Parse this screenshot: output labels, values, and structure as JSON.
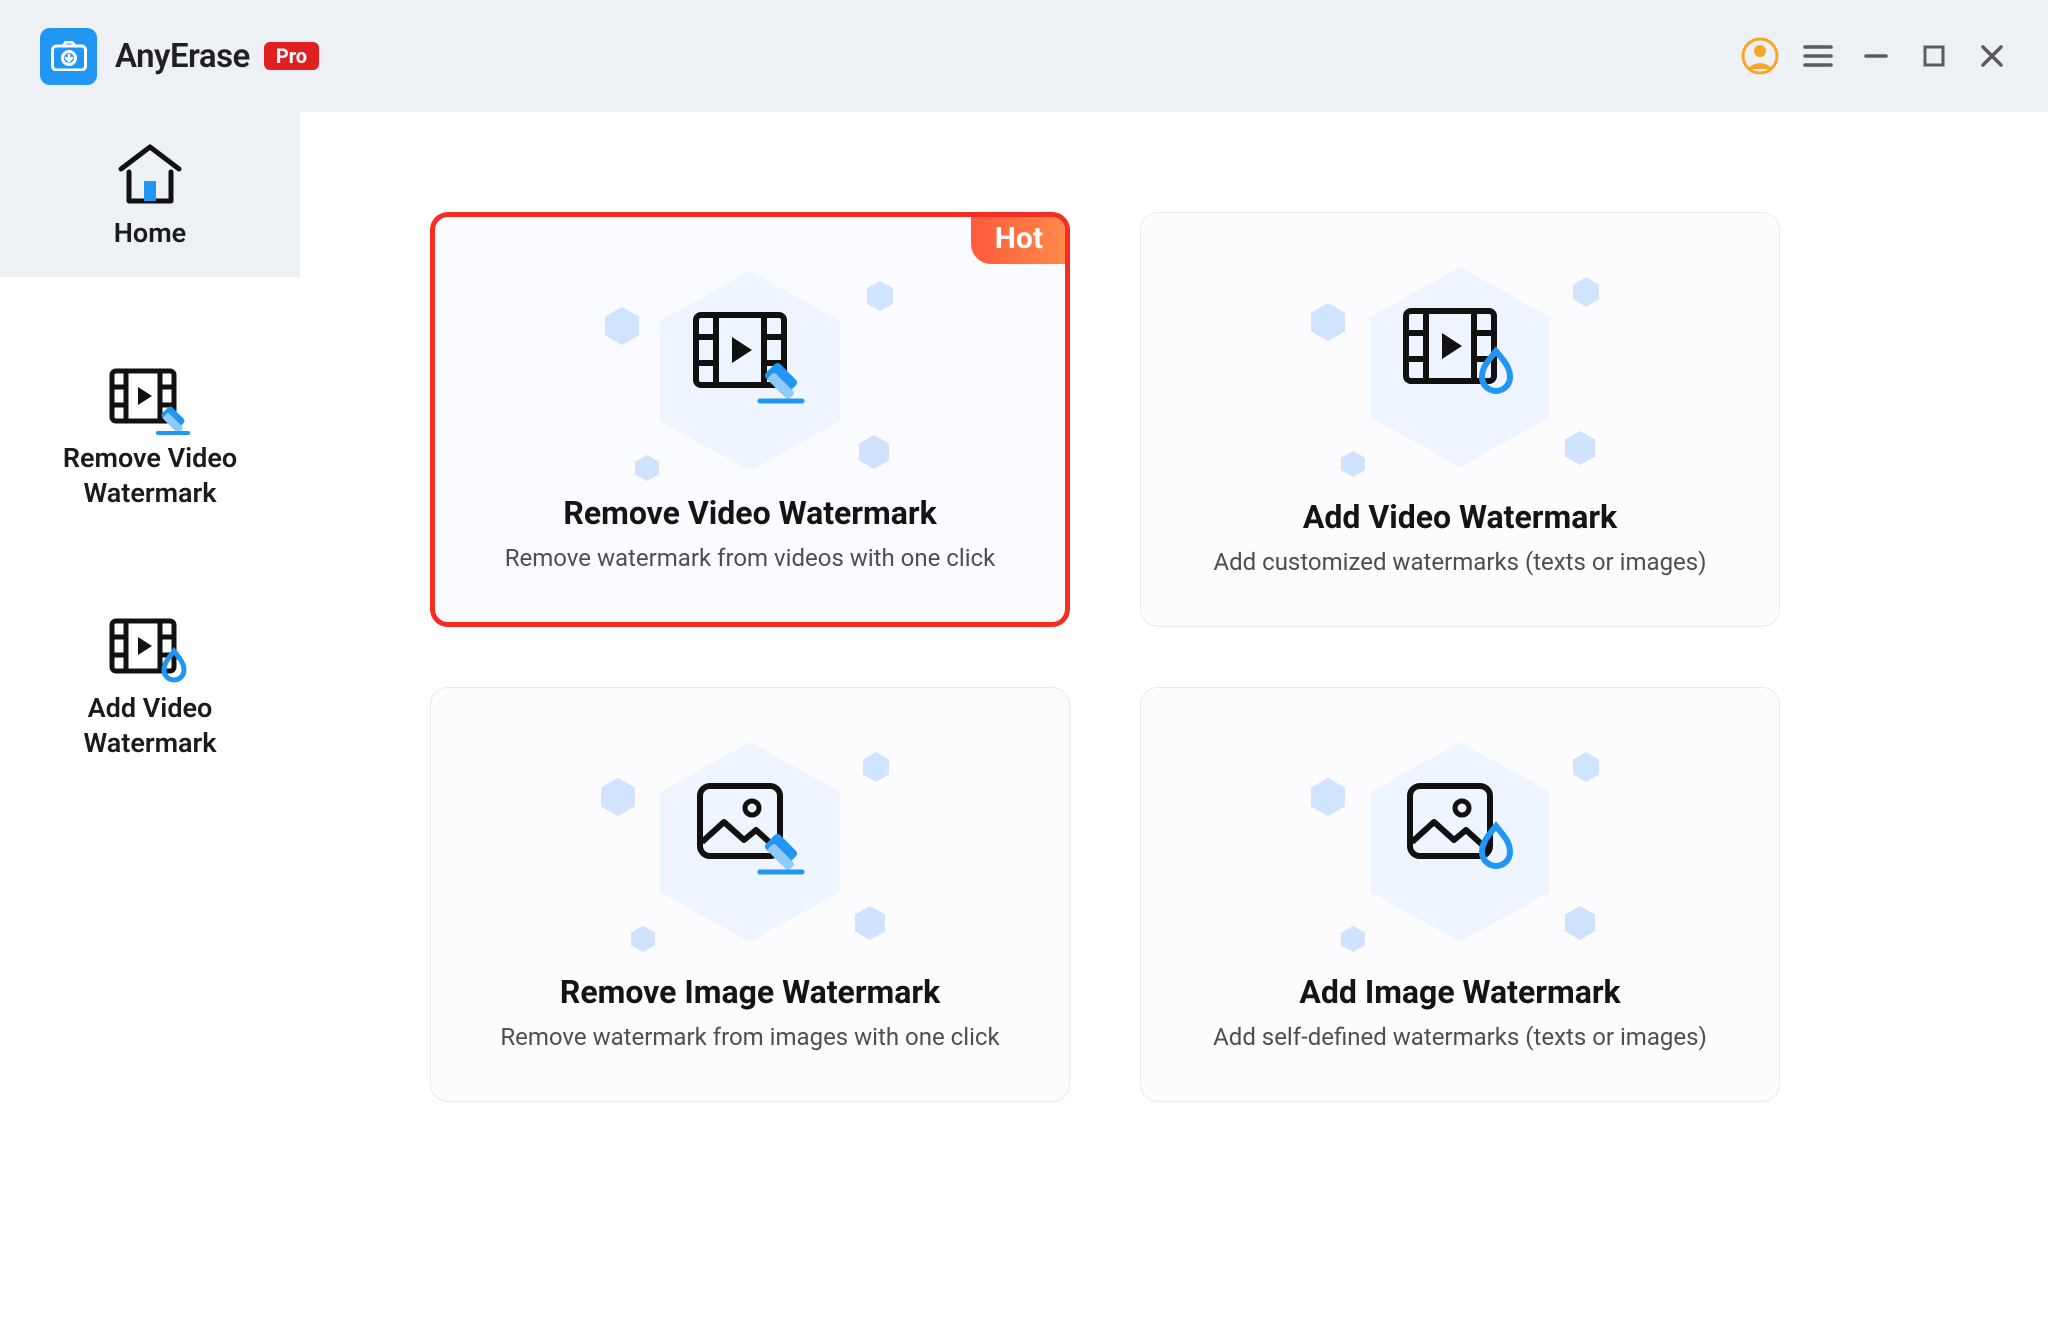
{
  "app": {
    "title": "AnyErase",
    "pro_badge": "Pro"
  },
  "sidebar": {
    "items": [
      {
        "label": "Home",
        "active": true
      },
      {
        "label": "Remove Video\nWatermark",
        "active": false
      },
      {
        "label": "Add Video\nWatermark",
        "active": false
      }
    ]
  },
  "cards": {
    "hot_label": "Hot",
    "remove_video": {
      "title": "Remove Video Watermark",
      "sub": "Remove watermark from videos with one click"
    },
    "add_video": {
      "title": "Add Video Watermark",
      "sub": "Add customized watermarks (texts or images)"
    },
    "remove_image": {
      "title": "Remove Image Watermark",
      "sub": "Remove watermark from images with one click"
    },
    "add_image": {
      "title": "Add Image Watermark",
      "sub": "Add self-defined watermarks  (texts or images)"
    }
  }
}
